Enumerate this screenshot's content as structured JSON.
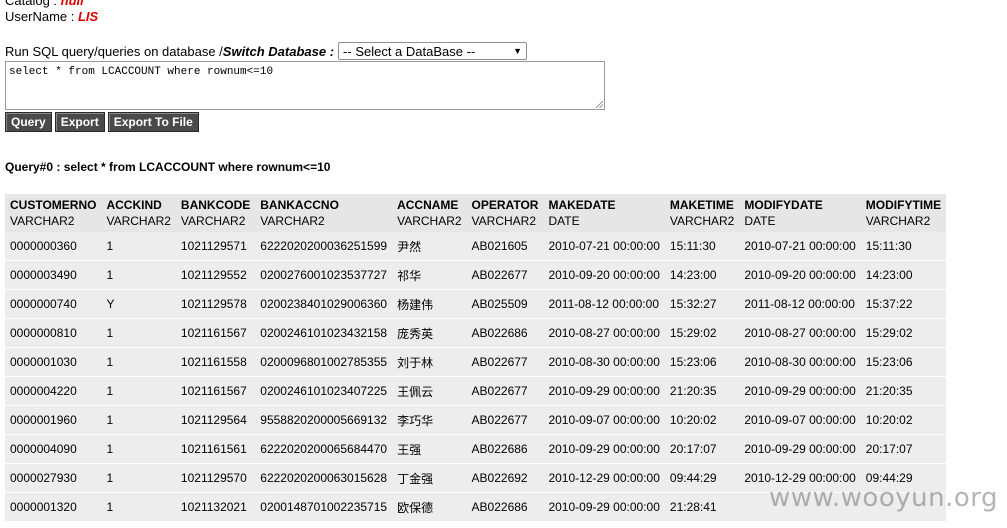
{
  "info": {
    "catalog_label": "Catalog : ",
    "catalog_value": "null",
    "username_label": "UserName : ",
    "username_value": "LIS"
  },
  "sql": {
    "prompt": "Run SQL query/queries on database / ",
    "switch_label": "Switch Database :",
    "db_select_value": "-- Select a DataBase --",
    "query_text": "select * from LCACCOUNT where rownum<=10"
  },
  "buttons": {
    "query": "Query",
    "export": "Export",
    "export_file": "Export To File"
  },
  "result_title": "Query#0 : select * from LCACCOUNT where rownum<=10",
  "table": {
    "columns": [
      {
        "name": "CUSTOMERNO",
        "type": "VARCHAR2"
      },
      {
        "name": "ACCKIND",
        "type": "VARCHAR2"
      },
      {
        "name": "BANKCODE",
        "type": "VARCHAR2"
      },
      {
        "name": "BANKACCNO",
        "type": "VARCHAR2"
      },
      {
        "name": "ACCNAME",
        "type": "VARCHAR2"
      },
      {
        "name": "OPERATOR",
        "type": "VARCHAR2"
      },
      {
        "name": "MAKEDATE",
        "type": "DATE"
      },
      {
        "name": "MAKETIME",
        "type": "VARCHAR2"
      },
      {
        "name": "MODIFYDATE",
        "type": "DATE"
      },
      {
        "name": "MODIFYTIME",
        "type": "VARCHAR2"
      }
    ],
    "rows": [
      [
        "0000000360",
        "1",
        "1021129571",
        "6222020200036251599",
        "尹然",
        "AB021605",
        "2010-07-21 00:00:00",
        "15:11:30",
        "2010-07-21 00:00:00",
        "15:11:30"
      ],
      [
        "0000003490",
        "1",
        "1021129552",
        "0200276001023537727",
        "祁华",
        "AB022677",
        "2010-09-20 00:00:00",
        "14:23:00",
        "2010-09-20 00:00:00",
        "14:23:00"
      ],
      [
        "0000000740",
        "Y",
        "1021129578",
        "0200238401029006360",
        "杨建伟",
        "AB025509",
        "2011-08-12 00:00:00",
        "15:32:27",
        "2011-08-12 00:00:00",
        "15:37:22"
      ],
      [
        "0000000810",
        "1",
        "1021161567",
        "0200246101023432158",
        "庞秀英",
        "AB022686",
        "2010-08-27 00:00:00",
        "15:29:02",
        "2010-08-27 00:00:00",
        "15:29:02"
      ],
      [
        "0000001030",
        "1",
        "1021161558",
        "0200096801002785355",
        "刘于林",
        "AB022677",
        "2010-08-30 00:00:00",
        "15:23:06",
        "2010-08-30 00:00:00",
        "15:23:06"
      ],
      [
        "0000004220",
        "1",
        "1021161567",
        "0200246101023407225",
        "王佩云",
        "AB022677",
        "2010-09-29 00:00:00",
        "21:20:35",
        "2010-09-29 00:00:00",
        "21:20:35"
      ],
      [
        "0000001960",
        "1",
        "1021129564",
        "9558820200005669132",
        "李巧华",
        "AB022677",
        "2010-09-07 00:00:00",
        "10:20:02",
        "2010-09-07 00:00:00",
        "10:20:02"
      ],
      [
        "0000004090",
        "1",
        "1021161561",
        "6222020200065684470",
        "王强",
        "AB022686",
        "2010-09-29 00:00:00",
        "20:17:07",
        "2010-09-29 00:00:00",
        "20:17:07"
      ],
      [
        "0000027930",
        "1",
        "1021129570",
        "6222020200063015628",
        "丁金强",
        "AB022692",
        "2010-12-29 00:00:00",
        "09:44:29",
        "2010-12-29 00:00:00",
        "09:44:29"
      ],
      [
        "0000001320",
        "1",
        "1021132021",
        "0200148701002235715",
        "欧保德",
        "AB022686",
        "2010-09-29 00:00:00",
        "21:28:41",
        "",
        ""
      ]
    ]
  },
  "watermark": "www.wooyun.org"
}
